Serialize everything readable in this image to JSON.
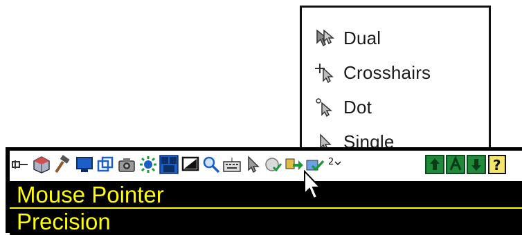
{
  "menu": {
    "items": [
      {
        "label": "Dual",
        "icon": "dual-pointer-icon"
      },
      {
        "label": "Crosshairs",
        "icon": "crosshairs-pointer-icon"
      },
      {
        "label": "Dot",
        "icon": "dot-pointer-icon"
      },
      {
        "label": "Single",
        "icon": "single-pointer-icon"
      }
    ]
  },
  "toolbar": {
    "icons": [
      "pin-icon",
      "cube-icon",
      "hammer-icon",
      "monitor-icon",
      "windows-icon",
      "camera-icon",
      "settings-icon",
      "ctrl-alt-del-icon",
      "screen-icon",
      "magnifier-icon",
      "keyboard-icon",
      "pointer-icon",
      "refresh-icon",
      "transfer-icon",
      "check-icon",
      "number-icon",
      "upload-icon",
      "text-icon",
      "download-icon",
      "help-icon"
    ]
  },
  "labels": {
    "row1": "Mouse Pointer",
    "row2": "Precision"
  },
  "colors": {
    "label_text": "#ffff00",
    "label_bg": "#000000",
    "accent_green": "#1e8a3a",
    "accent_blue": "#1b5fc9"
  }
}
